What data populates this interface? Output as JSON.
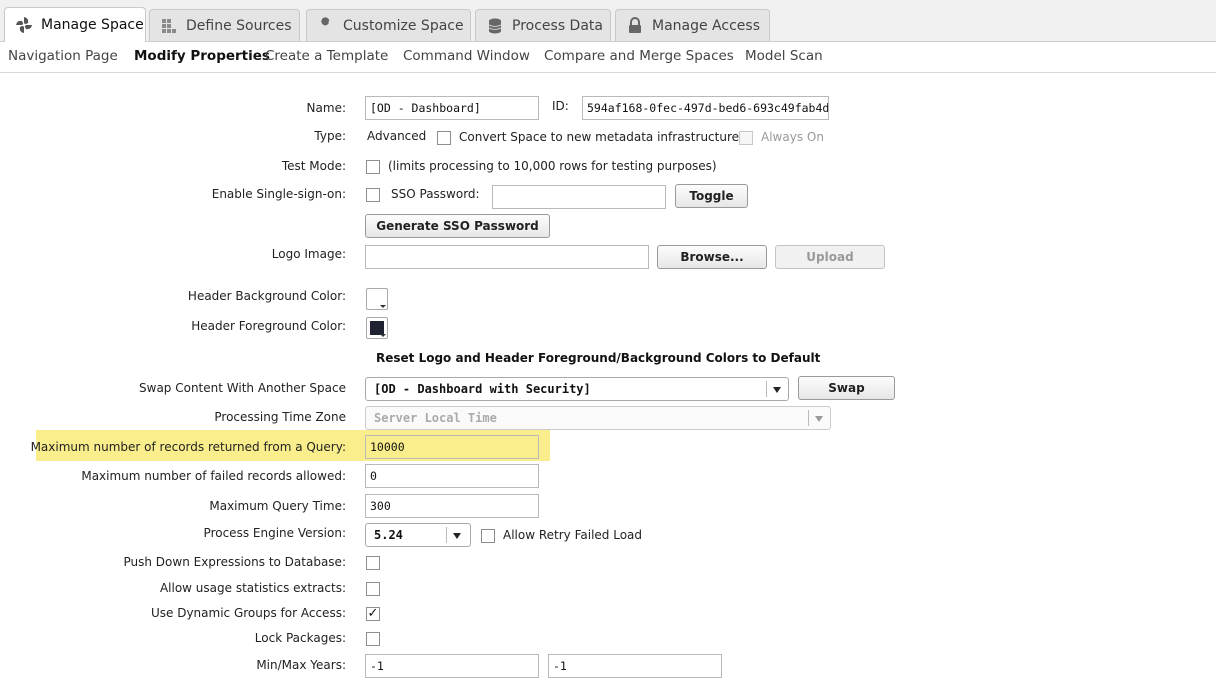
{
  "tabs": [
    {
      "label": "Manage Space",
      "icon": "pinwheel-icon",
      "active": true
    },
    {
      "label": "Define Sources",
      "icon": "grid-icon",
      "active": false
    },
    {
      "label": "Customize Space",
      "icon": "wrench-icon",
      "active": false
    },
    {
      "label": "Process Data",
      "icon": "database-icon",
      "active": false
    },
    {
      "label": "Manage Access",
      "icon": "lock-icon",
      "active": false
    }
  ],
  "subnav": [
    "Navigation Page",
    "Modify Properties",
    "Create a Template",
    "Command Window",
    "Compare and Merge Spaces",
    "Model Scan"
  ],
  "subnav_active": "Modify Properties",
  "form": {
    "name_label": "Name:",
    "name_value": "[OD - Dashboard]",
    "id_label": "ID:",
    "id_value": "594af168-0fec-497d-bed6-693c49fab4de",
    "type_label": "Type:",
    "type_value": "Advanced",
    "convert_label": "Convert Space to new metadata infrastructure",
    "always_on_label": "Always On",
    "test_mode_label": "Test Mode:",
    "test_mode_note": "(limits processing to 10,000 rows for testing purposes)",
    "sso_label": "Enable Single-sign-on:",
    "sso_password_label": "SSO Password:",
    "sso_password_value": "",
    "toggle_label": "Toggle",
    "generate_sso_label": "Generate SSO Password",
    "logo_label": "Logo Image:",
    "logo_value": "",
    "browse_label": "Browse...",
    "upload_label": "Upload",
    "header_bg_label": "Header Background Color:",
    "header_bg_color": "#ffffff",
    "header_fg_label": "Header Foreground Color:",
    "header_fg_color": "#1f2230",
    "reset_label": "Reset Logo and Header Foreground/Background Colors to Default",
    "swap_label": "Swap Content With Another Space",
    "swap_value": "[OD - Dashboard with Security]",
    "swap_button": "Swap",
    "timezone_label": "Processing Time Zone",
    "timezone_value": "Server Local Time",
    "max_records_label": "Maximum number of records returned from a Query:",
    "max_records_value": "10000",
    "max_failed_label": "Maximum number of failed records allowed:",
    "max_failed_value": "0",
    "max_time_label": "Maximum Query Time:",
    "max_time_value": "300",
    "engine_label": "Process Engine Version:",
    "engine_value": "5.24",
    "retry_label": "Allow Retry Failed Load",
    "pushdown_label": "Push Down Expressions to Database:",
    "usage_label": "Allow usage statistics extracts:",
    "dynamic_label": "Use Dynamic Groups for Access:",
    "dynamic_check": "✓",
    "lock_label": "Lock Packages:",
    "minmax_label": "Min/Max Years:",
    "min_year": "-1",
    "max_year": "-1"
  },
  "colors": {
    "highlight": "#f9ee8b",
    "tab_bar": "#f0f0f0"
  }
}
